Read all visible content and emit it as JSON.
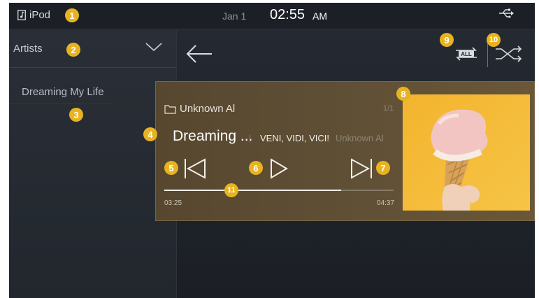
{
  "status_bar": {
    "source_label": "iPod",
    "date": "Jan 1",
    "time": "02:55",
    "ampm": "AM",
    "usb_icon": "usb-icon"
  },
  "category": {
    "label": "Artists",
    "icon": "chevron-down-icon"
  },
  "list": {
    "items": [
      {
        "label": "Dreaming My Life"
      }
    ]
  },
  "player": {
    "folder_name": "Unknown Al",
    "track_count": "1/1",
    "title": "Dreaming ...",
    "separator": "|",
    "artist": "VENI, VIDI, VICI!",
    "album": "Unknown Al",
    "elapsed": "03:25",
    "total": "04:37",
    "progress_fraction": 0.77,
    "colors": {
      "card": "#5f4f35",
      "accent_badge": "#e8b320",
      "progress": "#f2efe9"
    }
  },
  "controls": {
    "back_icon": "back-arrow-icon",
    "repeat_icon": "repeat-all-icon",
    "repeat_badge": "ALL",
    "shuffle_icon": "shuffle-icon",
    "prev_icon": "skip-previous-icon",
    "play_icon": "play-icon",
    "next_icon": "skip-next-icon"
  },
  "callouts": {
    "c1": "1",
    "c2": "2",
    "c3": "3",
    "c4": "4",
    "c5": "5",
    "c6": "6",
    "c7": "7",
    "c8": "8",
    "c9": "9",
    "c10": "10",
    "c11": "11"
  }
}
